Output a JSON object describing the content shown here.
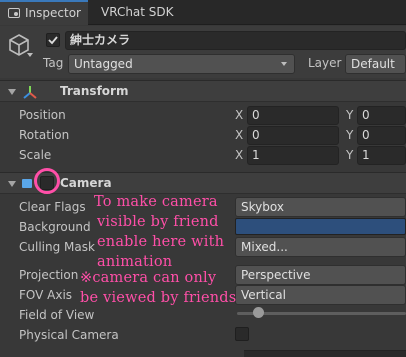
{
  "tabs": [
    {
      "label": "Inspector"
    },
    {
      "label": "VRChat SDK"
    }
  ],
  "object": {
    "name": "紳士カメラ",
    "tag_label": "Tag",
    "tag_value": "Untagged",
    "layer_label": "Layer",
    "layer_value": "Default"
  },
  "transform": {
    "title": "Transform",
    "rows": [
      {
        "label": "Position",
        "x": "0",
        "y": "0"
      },
      {
        "label": "Rotation",
        "x": "0",
        "y": "0"
      },
      {
        "label": "Scale",
        "x": "1",
        "y": "1"
      }
    ],
    "axis_x": "X",
    "axis_y": "Y"
  },
  "camera": {
    "title": "Camera",
    "clear_flags_label": "Clear Flags",
    "clear_flags_value": "Skybox",
    "background_label": "Background",
    "background_color": "#2d4f7c",
    "culling_mask_label": "Culling Mask",
    "culling_mask_value": "Mixed...",
    "projection_label": "Projection",
    "projection_value": "Perspective",
    "fov_axis_label": "FOV Axis",
    "fov_axis_value": "Vertical",
    "field_of_view_label": "Field of View",
    "field_of_view_level": 0.13,
    "physical_camera_label": "Physical Camera"
  },
  "annotation": {
    "lines": [
      "To make camera",
      "visible by friend",
      "enable here with",
      "animation",
      "※camera can only",
      "be viewed by friends"
    ],
    "color": "#ff4fa8"
  }
}
